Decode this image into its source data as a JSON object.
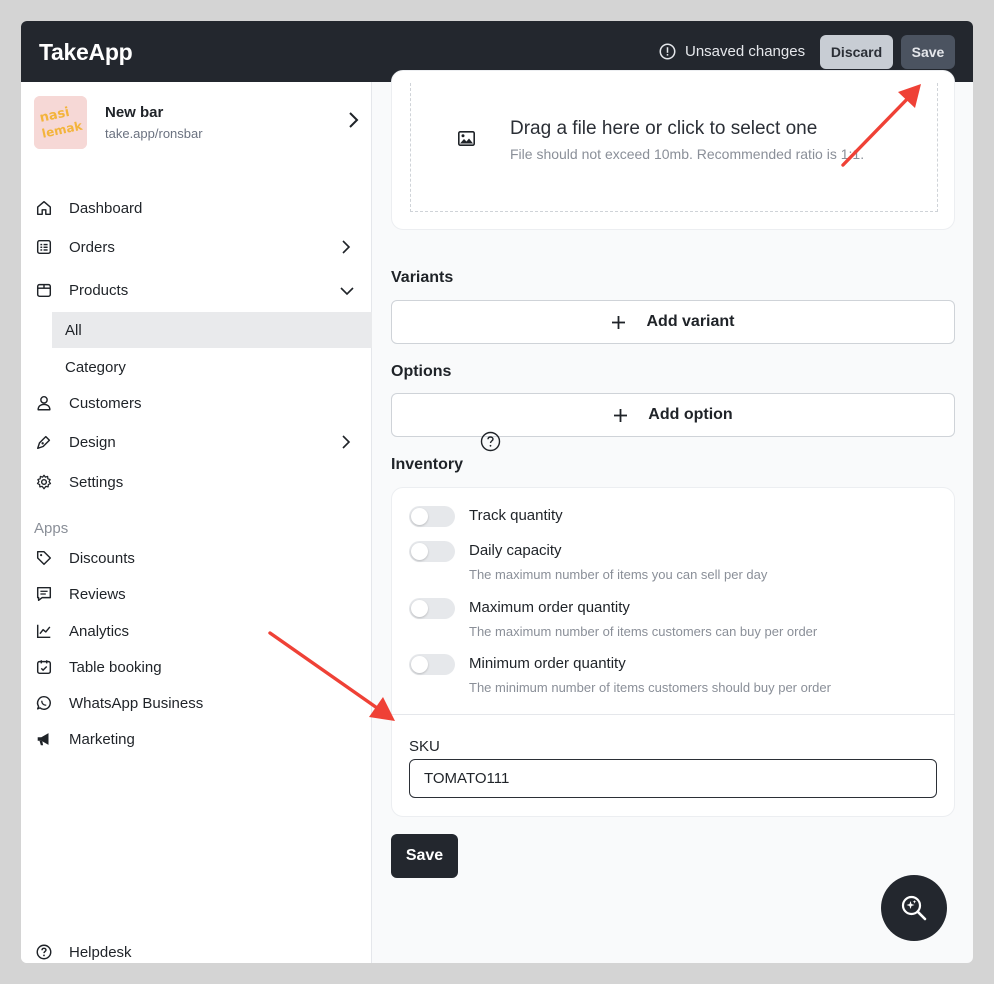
{
  "app": {
    "logo": "TakeApp"
  },
  "topbar": {
    "unsaved_text": "Unsaved changes",
    "discard_label": "Discard",
    "save_label": "Save"
  },
  "store": {
    "name": "New bar",
    "url": "take.app/ronsbar",
    "avatar_text": "nasi lemak"
  },
  "sidebar": {
    "items": [
      {
        "label": "Dashboard",
        "icon": "home-icon"
      },
      {
        "label": "Orders",
        "icon": "orders-icon"
      },
      {
        "label": "Products",
        "icon": "box-icon"
      },
      {
        "label": "Customers",
        "icon": "user-icon"
      },
      {
        "label": "Design",
        "icon": "pen-icon"
      },
      {
        "label": "Settings",
        "icon": "gear-icon"
      }
    ],
    "product_sub": [
      {
        "label": "All"
      },
      {
        "label": "Category"
      }
    ],
    "apps_label": "Apps",
    "apps": [
      {
        "label": "Discounts",
        "icon": "tag-icon"
      },
      {
        "label": "Reviews",
        "icon": "chat-icon"
      },
      {
        "label": "Analytics",
        "icon": "chart-icon"
      },
      {
        "label": "Table booking",
        "icon": "calendar-icon"
      },
      {
        "label": "WhatsApp Business",
        "icon": "whatsapp-icon"
      },
      {
        "label": "Marketing",
        "icon": "megaphone-icon"
      }
    ],
    "helpdesk": "Helpdesk"
  },
  "upload": {
    "title": "Drag a file here or click to select one",
    "subtitle": "File should not exceed 10mb. Recommended ratio is 1:1."
  },
  "variants": {
    "heading": "Variants",
    "button": "Add variant"
  },
  "options": {
    "heading": "Options",
    "button": "Add option"
  },
  "inventory": {
    "heading": "Inventory",
    "toggles": [
      {
        "label": "Track quantity",
        "desc": ""
      },
      {
        "label": "Daily capacity",
        "desc": "The maximum number of items you can sell per day"
      },
      {
        "label": "Maximum order quantity",
        "desc": "The maximum number of items customers can buy per order"
      },
      {
        "label": "Minimum order quantity",
        "desc": "The minimum number of items customers should buy per order"
      }
    ],
    "sku_label": "SKU",
    "sku_value": "TOMATO111"
  },
  "save_button": "Save",
  "colors": {
    "topbar": "#23272e",
    "annotation_arrow": "#ef4136"
  }
}
